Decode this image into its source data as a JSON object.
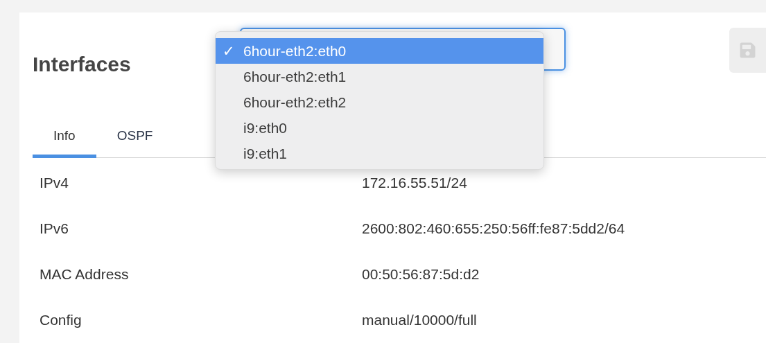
{
  "title": "Interfaces",
  "dropdown": {
    "options": [
      {
        "label": "6hour-eth2:eth0",
        "selected": true,
        "check": "✓"
      },
      {
        "label": "6hour-eth2:eth1",
        "selected": false
      },
      {
        "label": "6hour-eth2:eth2",
        "selected": false
      },
      {
        "label": "i9:eth0",
        "selected": false
      },
      {
        "label": "i9:eth1",
        "selected": false
      }
    ]
  },
  "tabs": [
    {
      "label": "Info",
      "selected": true
    },
    {
      "label": "OSPF",
      "selected": false
    }
  ],
  "rows": [
    {
      "label": "IPv4",
      "value": "172.16.55.51/24"
    },
    {
      "label": "IPv6",
      "value": "2600:802:460:655:250:56ff:fe87:5dd2/64"
    },
    {
      "label": "MAC Address",
      "value": "00:50:56:87:5d:d2"
    },
    {
      "label": "Config",
      "value": "manual/10000/full"
    }
  ]
}
